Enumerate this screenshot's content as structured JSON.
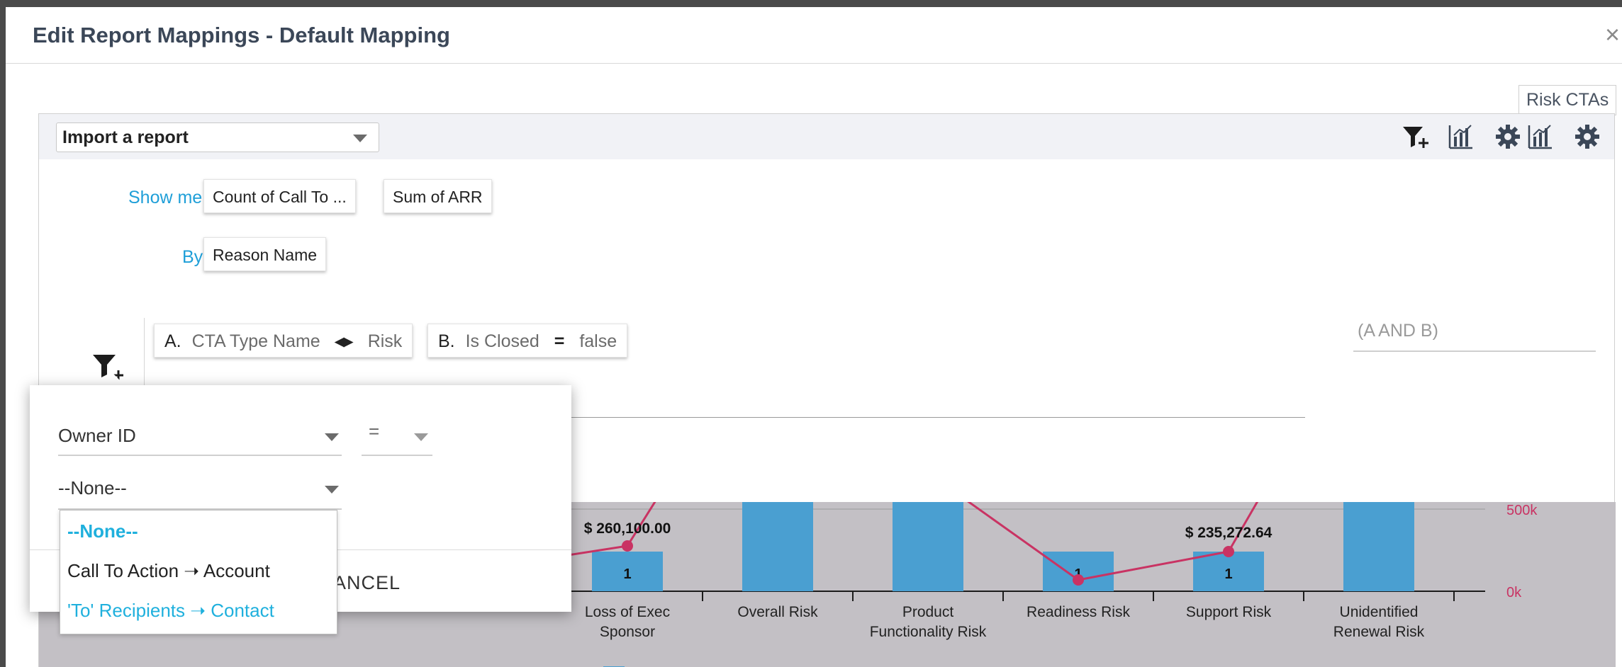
{
  "modal": {
    "title": "Edit Report Mappings - Default Mapping",
    "close_label": "×"
  },
  "chart_tag": "Risk CTAs",
  "toolbar": {
    "import_label": "Import a report"
  },
  "show_me": {
    "label": "Show me:",
    "chips": [
      "Count of Call To ...",
      "Sum of ARR"
    ]
  },
  "by": {
    "label": "By:",
    "chip": "Reason Name"
  },
  "filters": [
    {
      "letter": "A.",
      "field": "CTA Type Name",
      "op": "◂▸",
      "value": "Risk"
    },
    {
      "letter": "B.",
      "field": "Is Closed",
      "op": "=",
      "value": "false"
    }
  ],
  "filter_logic": {
    "placeholder": "(A AND B)"
  },
  "popover": {
    "field_label": "Owner ID",
    "operator_label": "=",
    "value_label": "--None--",
    "cancel_label": "ANCEL",
    "options": [
      {
        "label": "--None--",
        "selected": true
      },
      {
        "label": "Call To Action ➝ Account",
        "selected": false
      },
      {
        "label": "'To' Recipients ➝ Contact",
        "selected": false
      }
    ]
  },
  "chart_data": {
    "type": "bar",
    "categories": [
      "Loss of Exec Sponsor",
      "Overall Risk",
      "Product Functionality Risk",
      "Readiness Risk",
      "Support Risk",
      "Unidentified Renewal Risk"
    ],
    "series": [
      {
        "name": "",
        "type": "bar",
        "axis": "left",
        "values": [
          1,
          null,
          null,
          1,
          1,
          null
        ]
      },
      {
        "name": "",
        "type": "line",
        "axis": "right",
        "values": [
          260100.0,
          null,
          null,
          0,
          235272.64,
          null
        ]
      }
    ],
    "data_labels": {
      "bar": [
        "1",
        "",
        "",
        "1",
        "1",
        ""
      ],
      "line": [
        "$ 260,100.00",
        "",
        "",
        "",
        "$ 235,272.64",
        ""
      ]
    },
    "y2_ticks": [
      "0k",
      "500k"
    ],
    "legend": "bottom",
    "colors": {
      "bar": "#4a9fd1",
      "line": "#c93363"
    }
  }
}
